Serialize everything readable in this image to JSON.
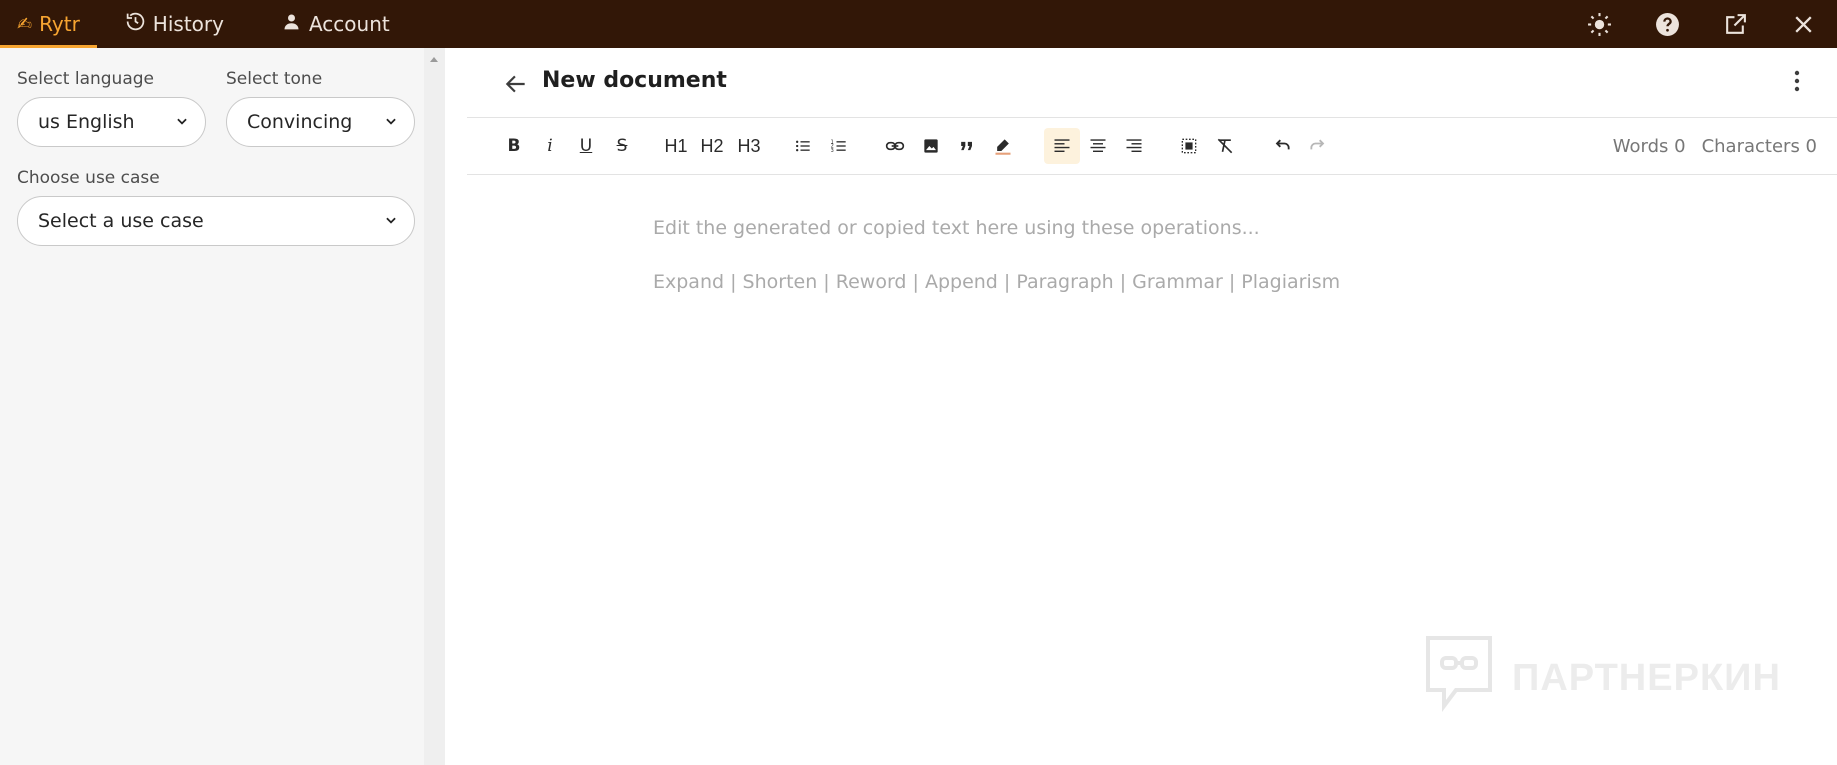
{
  "nav": {
    "brand": "Rytr",
    "history": "History",
    "account": "Account",
    "accent_color": "#f7a531",
    "bar_color": "#321707",
    "right_icons": [
      "theme-icon",
      "help-icon",
      "open-external-icon",
      "close-icon"
    ]
  },
  "sidebar": {
    "language_label": "Select language",
    "language_value": "us English",
    "tone_label": "Select tone",
    "tone_value": "Convincing",
    "use_case_label": "Choose use case",
    "use_case_value": "Select a use case"
  },
  "document": {
    "title": "New document"
  },
  "toolbar": {
    "bold": "B",
    "italic": "i",
    "underline": "U",
    "strike": "S",
    "h1": "H1",
    "h2": "H2",
    "h3": "H3",
    "words_label": "Words 0",
    "characters_label": "Characters 0"
  },
  "editor": {
    "placeholder_line1": "Edit the generated or copied text here using these operations...",
    "placeholder_line2": "Expand | Shorten | Reword | Append | Paragraph | Grammar | Plagiarism"
  },
  "watermark": {
    "text": "ПАРТНЕРКИН"
  }
}
